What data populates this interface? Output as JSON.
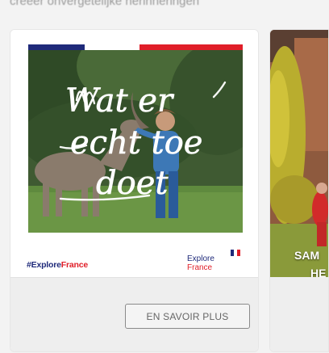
{
  "header": {
    "subtitle": "creëer onvergetelijke herinneringen"
  },
  "card1": {
    "photo_caption_lines": [
      "Wat er",
      "echt toe",
      "doet"
    ],
    "hashtag_part1": "#Explore",
    "hashtag_part2": "France",
    "logo_line1": "Explore",
    "logo_line2": "France",
    "cta_label": "EN SAVOIR PLUS"
  },
  "card2": {
    "caption_line1": "SAM",
    "caption_line2": "HE"
  },
  "colors": {
    "brand_blue": "#1f2a7a",
    "brand_red": "#e01e28",
    "card_bg": "#ffffff",
    "footer_bg": "#eeeeee",
    "button_border": "#8a8a8a"
  },
  "icons": {
    "flag": "french-flag-icon",
    "stripe": "tricolor-stripe"
  }
}
